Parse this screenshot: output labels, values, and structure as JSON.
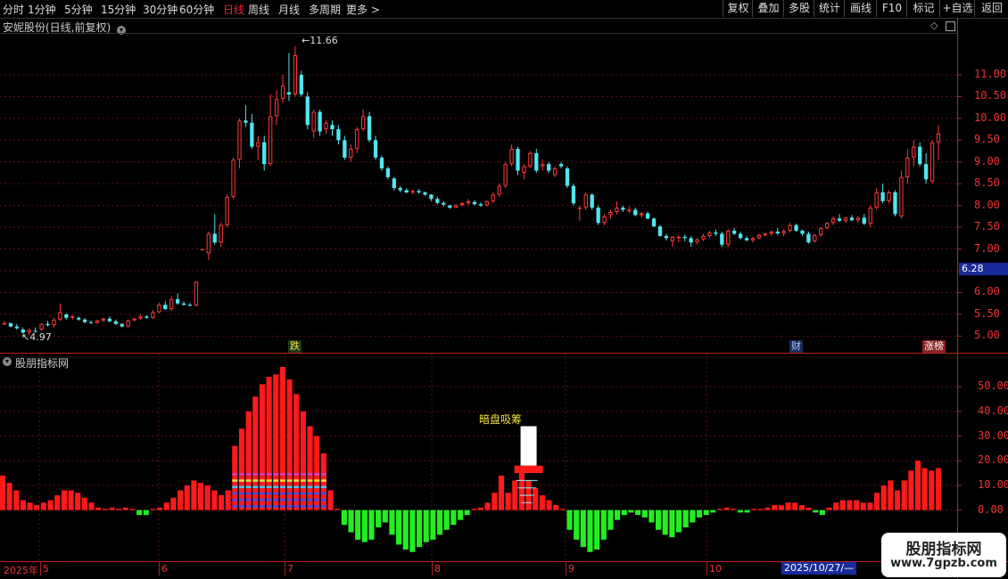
{
  "toolbar": {
    "periods": [
      "分时",
      "1分钟",
      "5分钟",
      "15分钟",
      "30分钟",
      "60分钟",
      "日线",
      "周线",
      "月线",
      "多周期",
      "更多 >"
    ],
    "active_period": "日线",
    "buttons": [
      "复权",
      "叠加",
      "多股",
      "统计",
      "画线",
      "F10",
      "标记",
      "+自选",
      "返回"
    ]
  },
  "main_panel": {
    "title": "安妮股份(日线,前复权)",
    "high_label": "11.66",
    "low_label": "4.97",
    "current_price": "6.28",
    "price_axis": [
      "11.00",
      "10.50",
      "10.00",
      "9.50",
      "9.00",
      "8.50",
      "8.00",
      "7.50",
      "7.00",
      "6.50",
      "6.00",
      "5.50",
      "5.00"
    ],
    "markers": [
      {
        "text": "跌",
        "color": "#f0e040",
        "bg": "#1a3a1a"
      },
      {
        "text": "财",
        "color": "#9cf",
        "bg": "#1a2a55"
      },
      {
        "text": "涨榜",
        "color": "#fff",
        "bg": "#8a2020"
      }
    ]
  },
  "indicator_panel": {
    "title": "股朋指标网",
    "signal_label": "暗盘吸筹",
    "value_axis": [
      "50.00",
      "40.00",
      "30.00",
      "20.00",
      "10.00",
      "0.00"
    ]
  },
  "date_axis": {
    "labels": [
      "2025年",
      "5",
      "6",
      "7",
      "8",
      "9",
      "10"
    ],
    "cursor_date": "2025/10/27/—"
  },
  "watermark": {
    "title": "股朋指标网",
    "url": "www.7gpzb.com"
  },
  "chart_data": {
    "type": "candlestick",
    "price_range": [
      4.7,
      11.9
    ],
    "candles": [
      [
        5.3,
        5.35,
        5.25,
        5.3
      ],
      [
        5.3,
        5.3,
        5.2,
        5.22
      ],
      [
        5.22,
        5.28,
        5.15,
        5.18
      ],
      [
        5.15,
        5.2,
        5.05,
        5.08
      ],
      [
        5.08,
        5.18,
        5.02,
        5.14
      ],
      [
        5.12,
        5.2,
        5.08,
        5.1
      ],
      [
        5.15,
        5.3,
        5.12,
        5.28
      ],
      [
        5.28,
        5.35,
        5.22,
        5.25
      ],
      [
        5.25,
        5.42,
        5.2,
        5.38
      ],
      [
        5.38,
        5.75,
        5.35,
        5.55
      ],
      [
        5.5,
        5.52,
        5.38,
        5.42
      ],
      [
        5.42,
        5.48,
        5.38,
        5.45
      ],
      [
        5.42,
        5.45,
        5.35,
        5.38
      ],
      [
        5.38,
        5.42,
        5.3,
        5.32
      ],
      [
        5.32,
        5.36,
        5.28,
        5.3
      ],
      [
        5.3,
        5.38,
        5.28,
        5.36
      ],
      [
        5.36,
        5.42,
        5.33,
        5.4
      ],
      [
        5.4,
        5.45,
        5.32,
        5.34
      ],
      [
        5.34,
        5.38,
        5.26,
        5.28
      ],
      [
        5.28,
        5.3,
        5.2,
        5.22
      ],
      [
        5.22,
        5.38,
        5.2,
        5.36
      ],
      [
        5.36,
        5.42,
        5.34,
        5.4
      ],
      [
        5.4,
        5.5,
        5.38,
        5.45
      ],
      [
        5.45,
        5.48,
        5.4,
        5.42
      ],
      [
        5.42,
        5.6,
        5.4,
        5.55
      ],
      [
        5.55,
        5.78,
        5.52,
        5.72
      ],
      [
        5.72,
        5.8,
        5.6,
        5.62
      ],
      [
        5.62,
        5.92,
        5.58,
        5.85
      ],
      [
        5.85,
        5.98,
        5.72,
        5.75
      ],
      [
        5.75,
        5.8,
        5.7,
        5.72
      ],
      [
        5.72,
        5.76,
        5.68,
        5.7
      ],
      [
        5.7,
        6.25,
        5.68,
        6.25
      ],
      [
        7.0,
        7.0,
        7.0,
        7.0
      ],
      [
        6.9,
        7.4,
        6.75,
        7.35
      ],
      [
        7.35,
        7.8,
        7.1,
        7.15
      ],
      [
        7.15,
        7.6,
        7.05,
        7.55
      ],
      [
        7.55,
        8.25,
        7.5,
        8.2
      ],
      [
        8.2,
        9.1,
        8.15,
        9.05
      ],
      [
        9.05,
        10.0,
        8.85,
        9.95
      ],
      [
        9.95,
        10.3,
        9.8,
        9.9
      ],
      [
        9.9,
        10.1,
        9.3,
        9.35
      ],
      [
        9.35,
        9.6,
        9.05,
        9.45
      ],
      [
        9.45,
        9.6,
        8.8,
        8.95
      ],
      [
        8.95,
        10.55,
        8.9,
        10.05
      ],
      [
        10.05,
        10.65,
        9.85,
        10.45
      ],
      [
        10.45,
        11.0,
        10.35,
        10.75
      ],
      [
        10.6,
        11.5,
        10.4,
        10.55
      ],
      [
        10.55,
        11.66,
        10.5,
        11.45
      ],
      [
        11.0,
        11.1,
        10.5,
        10.55
      ],
      [
        10.5,
        10.6,
        9.75,
        9.85
      ],
      [
        9.7,
        10.2,
        9.55,
        10.15
      ],
      [
        10.15,
        10.2,
        9.6,
        9.7
      ],
      [
        9.75,
        9.95,
        9.65,
        9.9
      ],
      [
        9.85,
        9.95,
        9.6,
        9.75
      ],
      [
        9.75,
        9.85,
        9.4,
        9.5
      ],
      [
        9.5,
        9.6,
        9.05,
        9.1
      ],
      [
        9.1,
        9.4,
        9.0,
        9.3
      ],
      [
        9.3,
        9.8,
        9.2,
        9.75
      ],
      [
        9.75,
        10.2,
        9.7,
        10.05
      ],
      [
        10.05,
        10.15,
        9.45,
        9.5
      ],
      [
        9.5,
        9.6,
        9.05,
        9.1
      ],
      [
        9.1,
        9.15,
        8.8,
        8.85
      ],
      [
        8.85,
        8.9,
        8.6,
        8.65
      ],
      [
        8.62,
        8.65,
        8.35,
        8.4
      ],
      [
        8.4,
        8.45,
        8.3,
        8.35
      ],
      [
        8.35,
        8.4,
        8.28,
        8.3
      ],
      [
        8.3,
        8.36,
        8.26,
        8.33
      ],
      [
        8.33,
        8.38,
        8.27,
        8.3
      ],
      [
        8.3,
        8.32,
        8.22,
        8.25
      ],
      [
        8.25,
        8.26,
        8.1,
        8.15
      ],
      [
        8.15,
        8.2,
        8.03,
        8.06
      ],
      [
        8.06,
        8.1,
        7.97,
        8.02
      ],
      [
        8.0,
        8.02,
        7.92,
        7.95
      ],
      [
        7.95,
        8.03,
        7.93,
        8.01
      ],
      [
        8.01,
        8.08,
        7.98,
        8.05
      ],
      [
        8.05,
        8.15,
        8.0,
        8.1
      ],
      [
        8.08,
        8.12,
        8.0,
        8.03
      ],
      [
        8.03,
        8.07,
        7.97,
        8.0
      ],
      [
        8.0,
        8.12,
        7.98,
        8.1
      ],
      [
        8.1,
        8.3,
        8.05,
        8.25
      ],
      [
        8.25,
        8.5,
        8.2,
        8.45
      ],
      [
        8.45,
        9.0,
        8.4,
        8.95
      ],
      [
        8.95,
        9.4,
        8.9,
        9.3
      ],
      [
        9.3,
        9.35,
        8.7,
        8.8
      ],
      [
        8.75,
        8.95,
        8.6,
        8.9
      ],
      [
        8.9,
        9.25,
        8.85,
        9.2
      ],
      [
        9.2,
        9.3,
        8.75,
        8.8
      ],
      [
        8.9,
        9.05,
        8.8,
        8.95
      ],
      [
        8.95,
        9.0,
        8.75,
        8.8
      ],
      [
        8.7,
        8.9,
        8.65,
        8.85
      ],
      [
        8.95,
        9.0,
        8.85,
        8.9
      ],
      [
        8.85,
        8.9,
        8.4,
        8.45
      ],
      [
        8.45,
        8.5,
        8.0,
        8.05
      ],
      [
        7.95,
        8.0,
        7.65,
        7.95
      ],
      [
        7.95,
        8.3,
        7.9,
        8.25
      ],
      [
        8.25,
        8.28,
        7.9,
        7.95
      ],
      [
        7.95,
        8.0,
        7.55,
        7.6
      ],
      [
        7.6,
        7.8,
        7.55,
        7.75
      ],
      [
        7.78,
        7.9,
        7.7,
        7.85
      ],
      [
        7.85,
        8.1,
        7.8,
        7.95
      ],
      [
        7.95,
        8.0,
        7.85,
        7.9
      ],
      [
        7.9,
        7.98,
        7.82,
        7.9
      ],
      [
        7.9,
        7.95,
        7.75,
        7.78
      ],
      [
        7.78,
        7.85,
        7.72,
        7.82
      ],
      [
        7.82,
        7.86,
        7.68,
        7.7
      ],
      [
        7.7,
        7.72,
        7.5,
        7.52
      ],
      [
        7.52,
        7.55,
        7.28,
        7.3
      ],
      [
        7.3,
        7.35,
        7.2,
        7.25
      ],
      [
        7.18,
        7.3,
        7.05,
        7.28
      ],
      [
        7.25,
        7.32,
        7.15,
        7.28
      ],
      [
        7.28,
        7.33,
        7.18,
        7.25
      ],
      [
        7.25,
        7.3,
        7.05,
        7.15
      ],
      [
        7.15,
        7.25,
        7.1,
        7.22
      ],
      [
        7.22,
        7.35,
        7.18,
        7.3
      ],
      [
        7.3,
        7.42,
        7.25,
        7.38
      ],
      [
        7.38,
        7.45,
        7.3,
        7.35
      ],
      [
        7.35,
        7.4,
        7.05,
        7.1
      ],
      [
        7.1,
        7.45,
        7.05,
        7.42
      ],
      [
        7.42,
        7.48,
        7.32,
        7.35
      ],
      [
        7.35,
        7.4,
        7.22,
        7.25
      ],
      [
        7.25,
        7.3,
        7.18,
        7.2
      ],
      [
        7.2,
        7.28,
        7.15,
        7.25
      ],
      [
        7.25,
        7.35,
        7.22,
        7.32
      ],
      [
        7.32,
        7.38,
        7.28,
        7.35
      ],
      [
        7.35,
        7.42,
        7.3,
        7.4
      ],
      [
        7.4,
        7.48,
        7.32,
        7.36
      ],
      [
        7.36,
        7.45,
        7.3,
        7.42
      ],
      [
        7.42,
        7.6,
        7.38,
        7.55
      ],
      [
        7.55,
        7.58,
        7.4,
        7.42
      ],
      [
        7.42,
        7.45,
        7.3,
        7.35
      ],
      [
        7.35,
        7.4,
        7.12,
        7.15
      ],
      [
        7.18,
        7.35,
        7.15,
        7.32
      ],
      [
        7.32,
        7.5,
        7.28,
        7.48
      ],
      [
        7.48,
        7.62,
        7.45,
        7.6
      ],
      [
        7.6,
        7.75,
        7.55,
        7.7
      ],
      [
        7.7,
        7.8,
        7.62,
        7.65
      ],
      [
        7.65,
        7.74,
        7.6,
        7.72
      ],
      [
        7.72,
        7.78,
        7.64,
        7.66
      ],
      [
        7.66,
        7.75,
        7.6,
        7.72
      ],
      [
        7.72,
        7.8,
        7.55,
        7.58
      ],
      [
        7.58,
        8.0,
        7.5,
        7.95
      ],
      [
        7.95,
        8.4,
        7.9,
        8.3
      ],
      [
        8.3,
        8.5,
        8.05,
        8.1
      ],
      [
        8.1,
        8.35,
        8.05,
        8.3
      ],
      [
        8.3,
        8.35,
        7.75,
        7.8
      ],
      [
        7.75,
        8.8,
        7.7,
        8.65
      ],
      [
        8.65,
        9.3,
        8.5,
        9.1
      ],
      [
        9.1,
        9.5,
        8.9,
        9.35
      ],
      [
        9.35,
        9.45,
        8.9,
        8.95
      ],
      [
        8.95,
        9.2,
        8.5,
        8.6
      ],
      [
        8.55,
        9.5,
        8.5,
        9.45
      ],
      [
        9.45,
        9.85,
        9.05,
        9.65
      ]
    ],
    "indicator": {
      "range": [
        -20,
        58
      ],
      "red_green_bars": [
        14,
        11,
        8,
        4,
        3,
        2,
        3,
        4,
        6,
        8,
        8,
        7,
        5,
        3,
        1,
        0.5,
        1,
        0.5,
        1,
        0.5,
        -2,
        -2,
        0.5,
        1,
        3,
        5,
        8,
        10,
        12,
        11,
        10,
        8,
        6,
        8,
        26,
        33,
        40,
        46,
        51,
        54,
        55,
        58,
        53,
        47,
        40,
        34,
        30,
        23,
        8,
        0.5,
        -6,
        -9,
        -12,
        -13,
        -12,
        -7,
        -5,
        -10,
        -14,
        -16,
        -17,
        -15,
        -13,
        -12,
        -10,
        -8,
        -6,
        -4,
        -2,
        0.5,
        1,
        3,
        7,
        14,
        7,
        12,
        15,
        12,
        9,
        6,
        4,
        2,
        0.5,
        -8,
        -12,
        -15,
        -17,
        -16,
        -12,
        -8,
        -4,
        -2,
        -1,
        -2,
        -3,
        -5,
        -8,
        -10,
        -11,
        -9,
        -7,
        -5,
        -3,
        -2,
        -1,
        0.5,
        1,
        0.5,
        -1,
        -1,
        0.5,
        0.5,
        1,
        2,
        2,
        3,
        3,
        2,
        1,
        -1,
        -2,
        1,
        3,
        4,
        4,
        4,
        3,
        3,
        7,
        10,
        12,
        8,
        12,
        16,
        20,
        17,
        16,
        17
      ],
      "signal_index": 77,
      "signal_box": [
        18,
        34
      ]
    }
  }
}
